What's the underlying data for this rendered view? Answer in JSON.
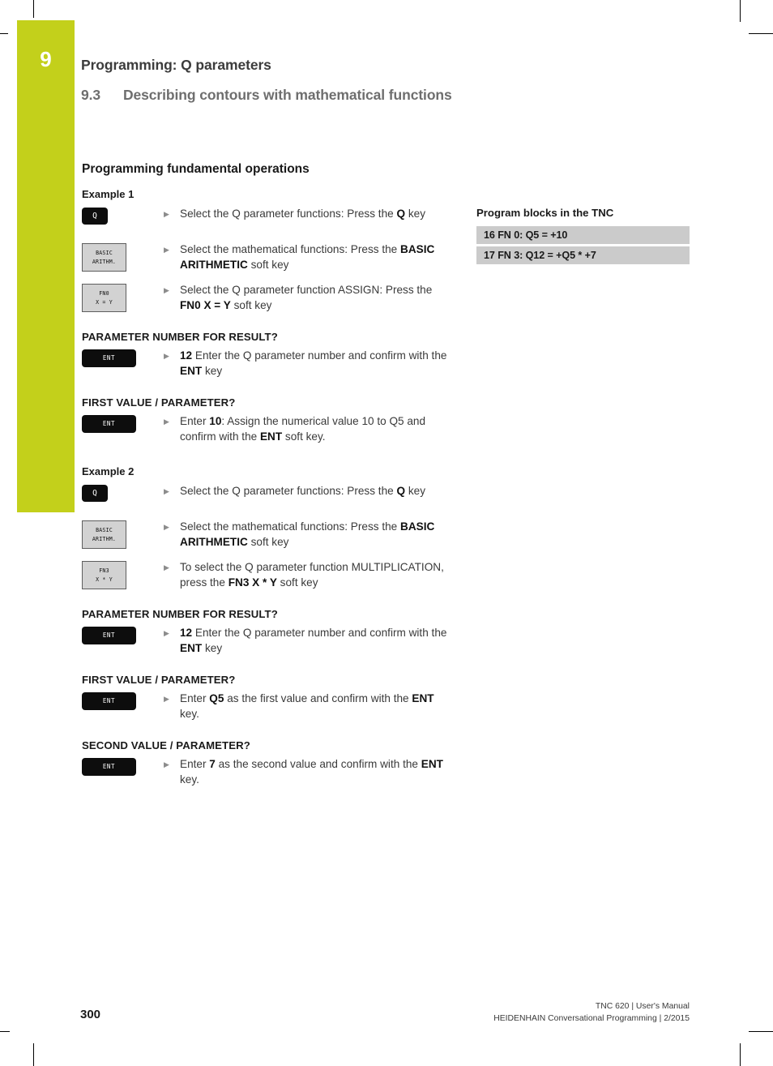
{
  "colors": {
    "chapter_tab": "#c3d01b",
    "block_row_bg": "#cbcbcb",
    "softkey_bg": "#d2d2d2",
    "hardkey_bg": "#0d0d0d"
  },
  "header": {
    "chapter_number": "9",
    "title": "Programming: Q parameters",
    "section_number": "9.3",
    "section_title": "Describing contours with mathematical functions"
  },
  "main": {
    "section_title": "Programming fundamental operations",
    "bullet_glyph": "▶",
    "example1": {
      "label": "Example 1",
      "steps": [
        {
          "key_type": "hardkey",
          "key_label": "Q",
          "text_html": "Select the Q parameter functions: Press the <b>Q</b> key"
        },
        {
          "key_type": "softkey",
          "key_line1": "BASIC",
          "key_line2": "ARITHM.",
          "text_html": "Select the mathematical functions: Press the <b>BASIC ARITHMETIC</b> soft key"
        },
        {
          "key_type": "softkey",
          "key_line1": "FN0",
          "key_line2": "X = Y",
          "text_html": "Select the Q parameter function ASSIGN: Press the <b>FN0 X = Y</b> soft key"
        }
      ],
      "prompts": [
        {
          "title": "PARAMETER NUMBER FOR RESULT?",
          "key_type": "hardkey",
          "key_label": "ENT",
          "text_html": "<b>12</b> Enter the Q parameter number and confirm with the <b>ENT</b> key"
        },
        {
          "title": "FIRST VALUE / PARAMETER?",
          "key_type": "hardkey",
          "key_label": "ENT",
          "text_html": "Enter <b>10</b>: Assign the numerical value 10 to Q5 and confirm with the <b>ENT</b> soft key."
        }
      ]
    },
    "example2": {
      "label": "Example 2",
      "steps": [
        {
          "key_type": "hardkey",
          "key_label": "Q",
          "text_html": "Select the Q parameter functions: Press the <b>Q</b> key"
        },
        {
          "key_type": "softkey",
          "key_line1": "BASIC",
          "key_line2": "ARITHM.",
          "text_html": "Select the mathematical functions: Press the <b>BASIC ARITHMETIC</b> soft key"
        },
        {
          "key_type": "softkey",
          "key_line1": "FN3",
          "key_line2": "X * Y",
          "text_html": "To select the Q parameter function MULTIPLICATION, press the <b>FN3 X * Y</b> soft key"
        }
      ],
      "prompts": [
        {
          "title": "PARAMETER NUMBER FOR RESULT?",
          "key_type": "hardkey",
          "key_label": "ENT",
          "text_html": "<b>12</b> Enter the Q parameter number and confirm with the <b>ENT</b> key"
        },
        {
          "title": "FIRST VALUE / PARAMETER?",
          "key_type": "hardkey",
          "key_label": "ENT",
          "text_html": "Enter <b>Q5</b> as the first value and confirm with the <b>ENT</b> key."
        },
        {
          "title": "SECOND VALUE / PARAMETER?",
          "key_type": "hardkey",
          "key_label": "ENT",
          "text_html": "Enter <b>7</b> as the second value and confirm with the <b>ENT</b> key."
        }
      ]
    }
  },
  "program_blocks": {
    "title": "Program blocks in the TNC",
    "rows": [
      "16 FN 0: Q5 = +10",
      "17 FN 3: Q12 = +Q5 * +7"
    ]
  },
  "footer": {
    "page_number": "300",
    "line1": "TNC 620 | User's Manual",
    "line2": "HEIDENHAIN Conversational Programming | 2/2015"
  }
}
